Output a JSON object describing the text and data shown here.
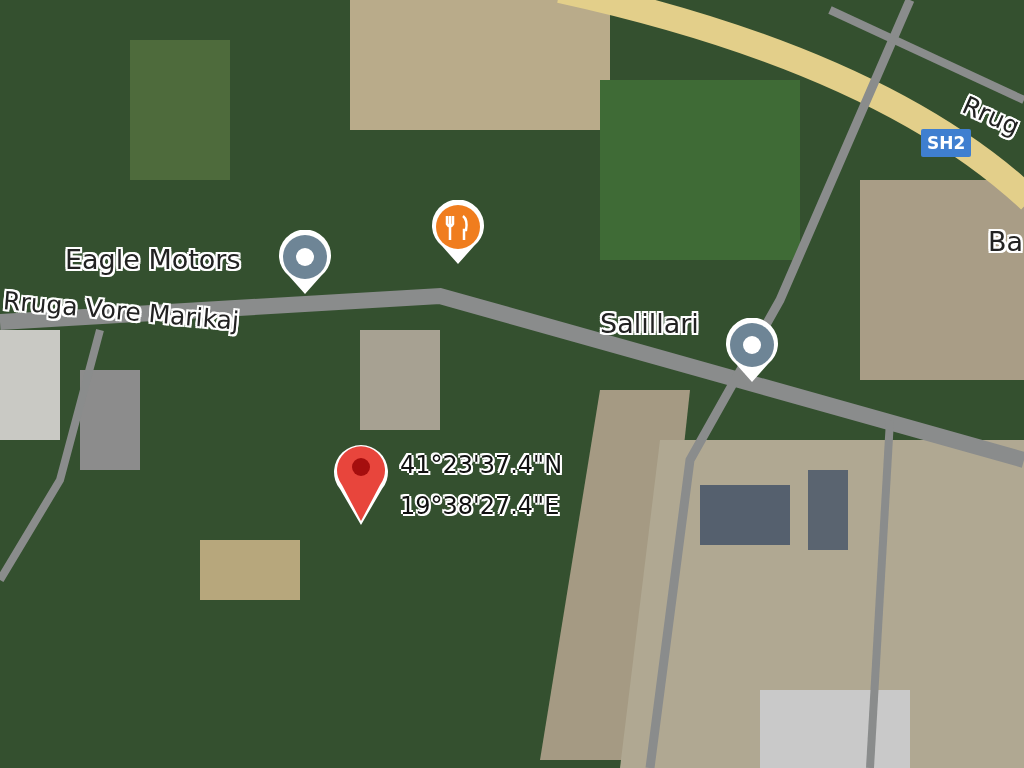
{
  "roads": [
    {
      "name": "Rruga Vore Marikaj"
    },
    {
      "name": "Rrug"
    }
  ],
  "highway_shield": "SH2",
  "places": [
    {
      "kind": "poi",
      "name": "Eagle Motors"
    },
    {
      "kind": "restaurant"
    },
    {
      "kind": "poi",
      "name": "Salillari"
    },
    {
      "kind": "label",
      "name": "Ba"
    }
  ],
  "dropped_pin": {
    "latitude": "41°23'37.4\"N",
    "longitude": "19°38'27.4\"E"
  }
}
